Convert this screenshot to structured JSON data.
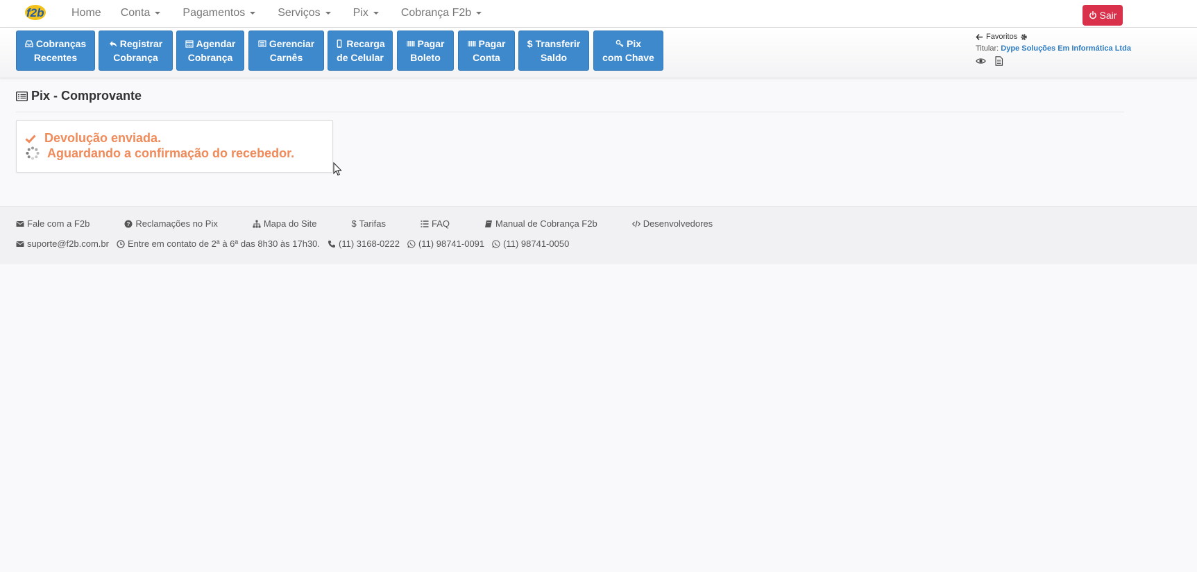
{
  "navbar": {
    "logo_text": "F2b",
    "links": [
      {
        "label": "Home",
        "has_caret": false
      },
      {
        "label": "Conta",
        "has_caret": true
      },
      {
        "label": "Pagamentos",
        "has_caret": true
      },
      {
        "label": "Serviços",
        "has_caret": true
      },
      {
        "label": "Pix",
        "has_caret": true
      },
      {
        "label": "Cobrança F2b",
        "has_caret": true
      }
    ],
    "logout_label": "Sair"
  },
  "toolbar": {
    "buttons": [
      {
        "line1": "Cobranças",
        "line2": "Recentes",
        "icon": "inbox-icon"
      },
      {
        "line1": "Registrar",
        "line2": "Cobrança",
        "icon": "reply-icon"
      },
      {
        "line1": "Agendar",
        "line2": "Cobrança",
        "icon": "calendar-icon"
      },
      {
        "line1": "Gerenciar",
        "line2": "Carnês",
        "icon": "list-alt-icon"
      },
      {
        "line1": "Recarga",
        "line2": "de Celular",
        "icon": "mobile-icon"
      },
      {
        "line1": "Pagar",
        "line2": "Boleto",
        "icon": "barcode-icon"
      },
      {
        "line1": "Pagar",
        "line2": "Conta",
        "icon": "barcode-icon"
      },
      {
        "line1": "Transferir",
        "line2": "Saldo",
        "icon": "dollar-icon"
      },
      {
        "line1": "Pix",
        "line2": "com Chave",
        "icon": "key-icon"
      }
    ],
    "favorites_label": "Favoritos",
    "titular_label": "Titular:",
    "titular_name": "Dype Soluções Em Informática Ltda"
  },
  "page": {
    "title": "Pix - Comprovante",
    "status_sent": "Devolução enviada.",
    "status_waiting": "Aguardando a confirmação do recebedor."
  },
  "footer": {
    "links": [
      {
        "label": "Fale com a F2b",
        "icon": "envelope-icon"
      },
      {
        "label": "Reclamações no Pix",
        "icon": "question-circle-icon"
      },
      {
        "label": "Mapa do Site",
        "icon": "sitemap-icon"
      },
      {
        "label": "Tarifas",
        "icon": "dollar-icon"
      },
      {
        "label": "FAQ",
        "icon": "list-icon"
      },
      {
        "label": "Manual de Cobrança F2b",
        "icon": "book-icon"
      },
      {
        "label": "Desenvolvedores",
        "icon": "code-icon"
      }
    ],
    "email": "suporte@f2b.com.br",
    "hours": "Entre em contato de 2ª à 6ª das 8h30 às 17h30.",
    "phone": "(11) 3168-0222",
    "whatsapp_1": "(11) 98741-0091",
    "whatsapp_2": "(11) 98741-0050"
  },
  "colors": {
    "primary_button": "#3e89cc",
    "danger_button": "#d9304b",
    "status_text": "#ef8a5a",
    "link": "#2f7bbf"
  }
}
